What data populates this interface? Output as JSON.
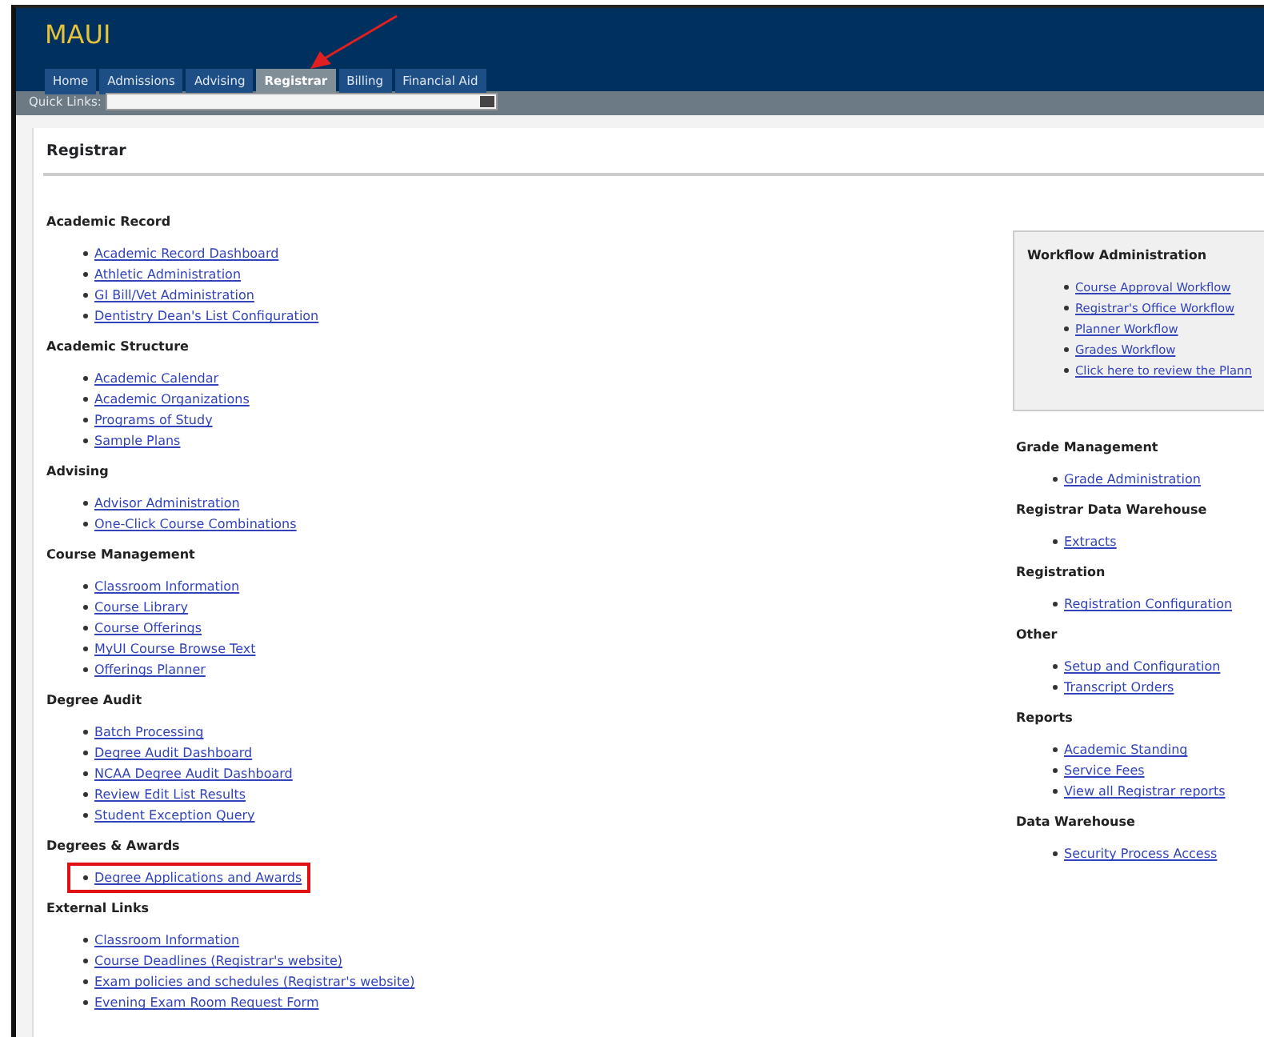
{
  "app": {
    "title": "MAUI"
  },
  "tabs": [
    {
      "label": "Home",
      "selected": false,
      "arrow": false
    },
    {
      "label": "Admissions",
      "selected": false,
      "arrow": false
    },
    {
      "label": "Advising",
      "selected": false,
      "arrow": false
    },
    {
      "label": "Registrar",
      "selected": true,
      "arrow": true
    },
    {
      "label": "Billing",
      "selected": false,
      "arrow": false
    },
    {
      "label": "Financial Aid",
      "selected": false,
      "arrow": false
    }
  ],
  "quick_links": {
    "label": "Quick Links:"
  },
  "page": {
    "title": "Registrar"
  },
  "left_sections": [
    {
      "heading": "Academic Record",
      "links": [
        {
          "label": "Academic Record Dashboard",
          "highlighted": false
        },
        {
          "label": "Athletic Administration",
          "highlighted": false
        },
        {
          "label": "GI Bill/Vet Administration",
          "highlighted": false
        },
        {
          "label": "Dentistry Dean's List Configuration",
          "highlighted": false
        }
      ]
    },
    {
      "heading": "Academic Structure",
      "links": [
        {
          "label": "Academic Calendar",
          "highlighted": false
        },
        {
          "label": "Academic Organizations",
          "highlighted": false
        },
        {
          "label": "Programs of Study",
          "highlighted": false
        },
        {
          "label": "Sample Plans",
          "highlighted": false
        }
      ]
    },
    {
      "heading": "Advising",
      "links": [
        {
          "label": "Advisor Administration",
          "highlighted": false
        },
        {
          "label": "One-Click Course Combinations",
          "highlighted": false
        }
      ]
    },
    {
      "heading": "Course Management",
      "links": [
        {
          "label": "Classroom Information",
          "highlighted": false
        },
        {
          "label": "Course Library",
          "highlighted": false
        },
        {
          "label": "Course Offerings",
          "highlighted": false
        },
        {
          "label": "MyUI Course Browse Text",
          "highlighted": false
        },
        {
          "label": "Offerings Planner",
          "highlighted": false
        }
      ]
    },
    {
      "heading": "Degree Audit",
      "links": [
        {
          "label": "Batch Processing",
          "highlighted": false
        },
        {
          "label": "Degree Audit Dashboard",
          "highlighted": false
        },
        {
          "label": "NCAA Degree Audit Dashboard",
          "highlighted": false
        },
        {
          "label": "Review Edit List Results",
          "highlighted": false
        },
        {
          "label": "Student Exception Query",
          "highlighted": false
        }
      ]
    },
    {
      "heading": "Degrees & Awards",
      "links": [
        {
          "label": "Degree Applications and Awards",
          "highlighted": true
        }
      ]
    },
    {
      "heading": "External Links",
      "links": [
        {
          "label": "Classroom Information",
          "highlighted": false
        },
        {
          "label": "Course Deadlines (Registrar's website)",
          "highlighted": false
        },
        {
          "label": "Exam policies and schedules (Registrar's website)",
          "highlighted": false
        },
        {
          "label": "Evening Exam Room Request Form",
          "highlighted": false
        }
      ]
    }
  ],
  "workflow_box": {
    "heading": "Workflow Administration",
    "links": [
      {
        "label": "Course Approval Workflow",
        "highlighted": false
      },
      {
        "label": "Registrar's Office Workflow",
        "highlighted": false
      },
      {
        "label": "Planner Workflow",
        "highlighted": false
      },
      {
        "label": "Grades Workflow",
        "highlighted": false
      },
      {
        "label": "Click here to review the Plann",
        "highlighted": false
      }
    ]
  },
  "right_sections": [
    {
      "heading": "Grade Management",
      "links": [
        {
          "label": "Grade Administration",
          "highlighted": false
        }
      ]
    },
    {
      "heading": "Registrar Data Warehouse",
      "links": [
        {
          "label": "Extracts",
          "highlighted": false
        }
      ]
    },
    {
      "heading": "Registration",
      "links": [
        {
          "label": "Registration Configuration",
          "highlighted": false
        }
      ]
    },
    {
      "heading": "Other",
      "links": [
        {
          "label": "Setup and Configuration",
          "highlighted": false
        },
        {
          "label": "Transcript Orders",
          "highlighted": false
        }
      ]
    },
    {
      "heading": "Reports",
      "links": [
        {
          "label": "Academic Standing",
          "highlighted": false
        },
        {
          "label": "Service Fees",
          "highlighted": false
        },
        {
          "label": "View all Registrar reports",
          "highlighted": false
        }
      ]
    },
    {
      "heading": "Data Warehouse",
      "links": [
        {
          "label": "Security Process Access",
          "highlighted": false
        }
      ]
    }
  ]
}
